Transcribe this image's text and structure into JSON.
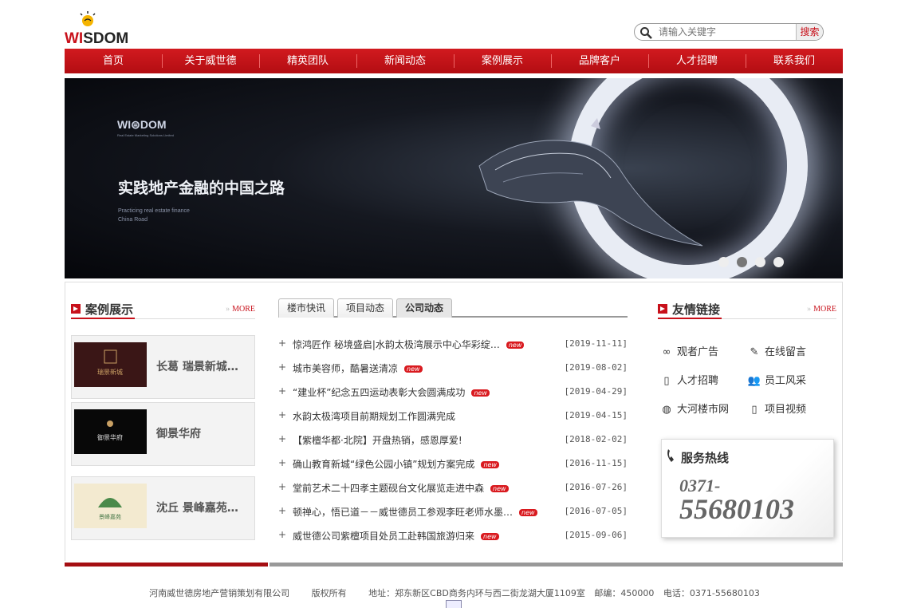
{
  "logo": {
    "text_w": "WI",
    "text_rest": "DOM",
    "text_mid": "S"
  },
  "search": {
    "placeholder": "请输入关键字",
    "button": "搜索"
  },
  "nav": [
    "首页",
    "关于威世德",
    "精英团队",
    "新闻动态",
    "案例展示",
    "品牌客户",
    "人才招聘",
    "联系我们"
  ],
  "banner": {
    "logo": "WI⊜DOM",
    "logo_sub": "Real Estate Marketing Solutions Limited",
    "title": "实践地产金融的中国之路",
    "sub_line1": "Practicing real estate finance",
    "sub_line2": "China Road",
    "slides": 4,
    "active_slide": 2
  },
  "cases": {
    "title": "案例展示",
    "more": "MORE",
    "items": [
      {
        "name": "长葛 瑞景新城…",
        "thumb_label": "瑞景新城"
      },
      {
        "name": "御景华府",
        "thumb_label": "御景华府"
      },
      {
        "name": "沈丘 景峰嘉苑…",
        "thumb_label": "景峰嘉苑"
      }
    ]
  },
  "news": {
    "tabs": [
      "楼市快讯",
      "项目动态",
      "公司动态"
    ],
    "active_tab": 2,
    "new_badge": "new",
    "items": [
      {
        "title": "惊鸿匠作 秘境盛启|水韵太极湾展示中心华彩绽…",
        "date": "[2019-11-11]",
        "is_new": true
      },
      {
        "title": "城市美容师，酷暑送清凉",
        "date": "[2019-08-02]",
        "is_new": true
      },
      {
        "title": "“建业杯”纪念五四运动表彰大会圆满成功",
        "date": "[2019-04-29]",
        "is_new": true
      },
      {
        "title": "水韵太极湾项目前期规划工作圆满完成",
        "date": "[2019-04-15]",
        "is_new": false
      },
      {
        "title": "【紫檀华都·北院】开盘热销，感恩厚爱!",
        "date": "[2018-02-02]",
        "is_new": false
      },
      {
        "title": "确山教育新城“绿色公园小镇”规划方案完成",
        "date": "[2016-11-15]",
        "is_new": true
      },
      {
        "title": "堂前艺术二十四孝主题砚台文化展览走进中森",
        "date": "[2016-07-26]",
        "is_new": true
      },
      {
        "title": "顿禅心，悟已道－－威世德员工参观李旺老师水墨…",
        "date": "[2016-07-05]",
        "is_new": true
      },
      {
        "title": "威世德公司紫檀项目处员工赴韩国旅游归来",
        "date": "[2015-09-06]",
        "is_new": true
      }
    ]
  },
  "links": {
    "title": "友情链接",
    "more": "MORE",
    "items": [
      {
        "label": "观者广告",
        "icon": "rings-icon"
      },
      {
        "label": "在线留言",
        "icon": "pen-icon"
      },
      {
        "label": "人才招聘",
        "icon": "phone-icon"
      },
      {
        "label": "员工风采",
        "icon": "people-icon"
      },
      {
        "label": "大河楼市网",
        "icon": "globe-icon"
      },
      {
        "label": "项目视频",
        "icon": "mobile-icon"
      }
    ]
  },
  "hotline": {
    "title": "服务热线",
    "area": "0371-",
    "number": "55680103"
  },
  "footer": {
    "company": "河南威世德房地产营销策划有限公司",
    "rights": "版权所有",
    "address": "地址：郑东新区CBD商务内环与西二街龙湖大厦1109室",
    "postcode": "邮编：450000",
    "phone": "电话：0371-55680103"
  },
  "colors": {
    "brand_red": "#c8101a",
    "nav_red": "#d21a1f"
  }
}
